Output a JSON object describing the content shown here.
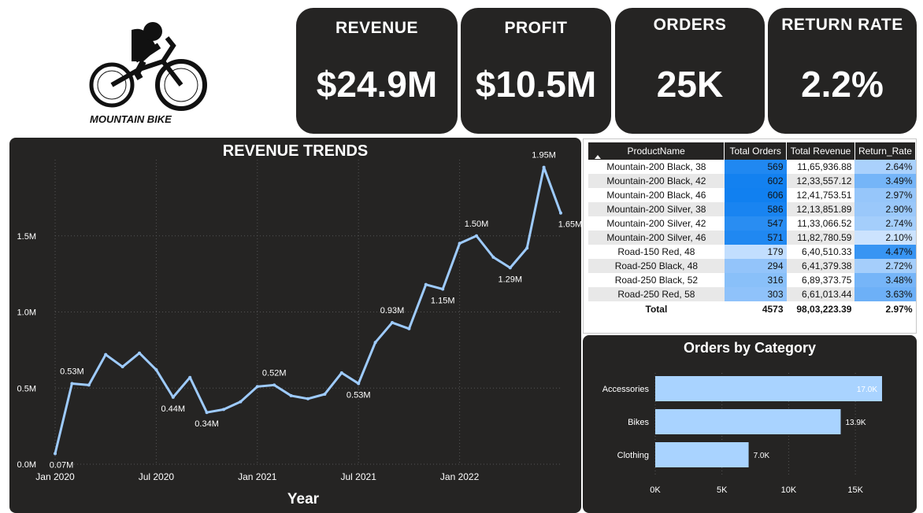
{
  "logo": {
    "text": "MOUNTAIN BIKE"
  },
  "kpis": [
    {
      "label": "REVENUE",
      "value": "$24.9M"
    },
    {
      "label": "PROFIT",
      "value": "$10.5M"
    },
    {
      "label": "ORDERS",
      "value": "25K"
    },
    {
      "label": "RETURN RATE",
      "value": "2.2%"
    }
  ],
  "revenue_trend": {
    "title": "REVENUE TRENDS",
    "xlabel": "Year",
    "y_ticks": [
      "0.0M",
      "0.5M",
      "1.0M",
      "1.5M"
    ],
    "x_ticks": [
      "Jan 2020",
      "Jul 2020",
      "Jan 2021",
      "Jul 2021",
      "Jan 2022"
    ]
  },
  "table": {
    "headers": [
      "ProductName",
      "Total Orders",
      "Total Revenue",
      "Return_Rate"
    ],
    "rows": [
      [
        "Mountain-200 Black, 38",
        "569",
        "11,65,936.88",
        "2.64%"
      ],
      [
        "Mountain-200 Black, 42",
        "602",
        "12,33,557.12",
        "3.49%"
      ],
      [
        "Mountain-200 Black, 46",
        "606",
        "12,41,753.51",
        "2.97%"
      ],
      [
        "Mountain-200 Silver, 38",
        "586",
        "12,13,851.89",
        "2.90%"
      ],
      [
        "Mountain-200 Silver, 42",
        "547",
        "11,33,066.52",
        "2.74%"
      ],
      [
        "Mountain-200 Silver, 46",
        "571",
        "11,82,780.59",
        "2.10%"
      ],
      [
        "Road-150 Red, 48",
        "179",
        "6,40,510.33",
        "4.47%"
      ],
      [
        "Road-250 Black, 48",
        "294",
        "6,41,379.38",
        "2.72%"
      ],
      [
        "Road-250 Black, 52",
        "316",
        "6,89,373.75",
        "3.48%"
      ],
      [
        "Road-250 Red, 58",
        "303",
        "6,61,013.44",
        "3.63%"
      ]
    ],
    "total": [
      "Total",
      "4573",
      "98,03,223.39",
      "2.97%"
    ]
  },
  "orders_by_category": {
    "title": "Orders by Category",
    "x_ticks": [
      "0K",
      "5K",
      "10K",
      "15K"
    ]
  },
  "chart_data": [
    {
      "type": "line",
      "title": "REVENUE TRENDS",
      "xlabel": "Year",
      "ylabel": "",
      "ylim": [
        0,
        2.0
      ],
      "unit": "M",
      "x": [
        "2020-01",
        "2020-02",
        "2020-03",
        "2020-04",
        "2020-05",
        "2020-06",
        "2020-07",
        "2020-08",
        "2020-09",
        "2020-10",
        "2020-11",
        "2020-12",
        "2021-01",
        "2021-02",
        "2021-03",
        "2021-04",
        "2021-05",
        "2021-06",
        "2021-07",
        "2021-08",
        "2021-09",
        "2021-10",
        "2021-11",
        "2021-12",
        "2022-01",
        "2022-02",
        "2022-03",
        "2022-04",
        "2022-05",
        "2022-06"
      ],
      "values": [
        0.07,
        0.53,
        0.52,
        0.72,
        0.64,
        0.73,
        0.62,
        0.44,
        0.57,
        0.34,
        0.36,
        0.41,
        0.51,
        0.52,
        0.45,
        0.43,
        0.46,
        0.6,
        0.53,
        0.8,
        0.93,
        0.89,
        1.18,
        1.15,
        1.45,
        1.5,
        1.36,
        1.29,
        1.42,
        1.95,
        1.65
      ],
      "data_labels": [
        {
          "index": 0,
          "text": "0.07M"
        },
        {
          "index": 1,
          "text": "0.53M"
        },
        {
          "index": 7,
          "text": "0.44M"
        },
        {
          "index": 9,
          "text": "0.34M"
        },
        {
          "index": 13,
          "text": "0.52M"
        },
        {
          "index": 18,
          "text": "0.53M"
        },
        {
          "index": 20,
          "text": "0.93M"
        },
        {
          "index": 23,
          "text": "1.15M"
        },
        {
          "index": 25,
          "text": "1.50M"
        },
        {
          "index": 27,
          "text": "1.29M"
        },
        {
          "index": 29,
          "text": "1.95M"
        },
        {
          "index": 30,
          "text": "1.65M"
        }
      ],
      "grid": true
    },
    {
      "type": "bar",
      "orientation": "horizontal",
      "title": "Orders by Category",
      "categories": [
        "Accessories",
        "Bikes",
        "Clothing"
      ],
      "values": [
        17.0,
        13.9,
        7.0
      ],
      "value_labels": [
        "17.0K",
        "13.9K",
        "7.0K"
      ],
      "xlim": [
        0,
        17
      ],
      "unit": "K",
      "color": "#a9d3ff",
      "grid": true
    }
  ],
  "colors": {
    "panel_bg": "#252423",
    "line": "#9ecbff",
    "bar": "#a9d3ff",
    "table_header": "#252423"
  }
}
